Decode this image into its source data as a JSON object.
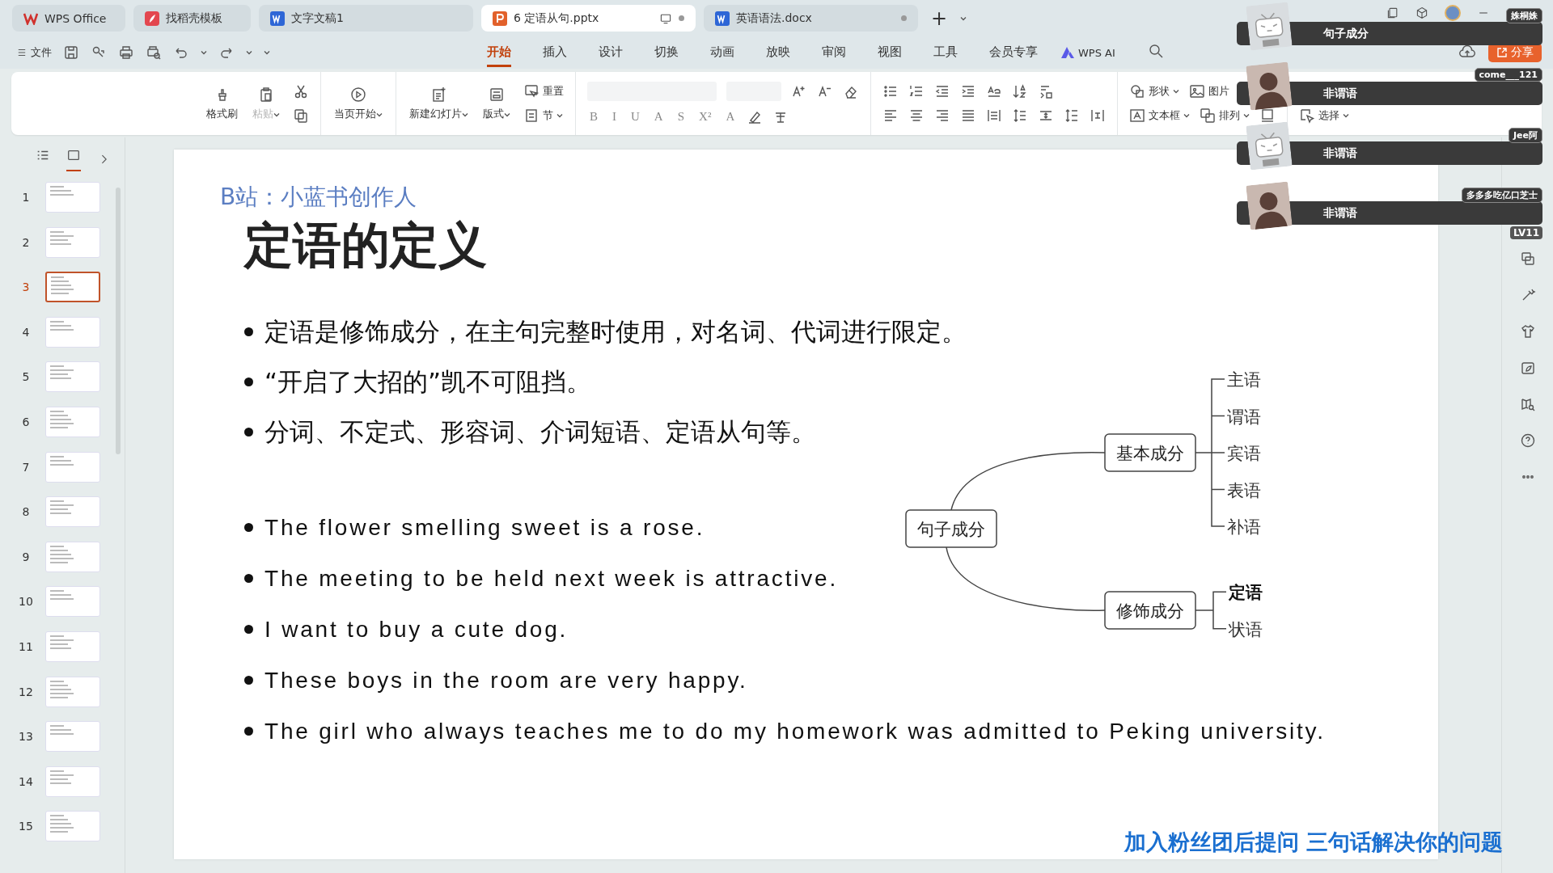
{
  "tabs": [
    {
      "kind": "home",
      "label": "WPS Office",
      "selected": false,
      "dot": false
    },
    {
      "kind": "template",
      "label": "找稻壳模板",
      "selected": false,
      "dot": false
    },
    {
      "kind": "doc",
      "label": "文字文稿1",
      "selected": false,
      "dot": false
    },
    {
      "kind": "ppt",
      "label": "6 定语从句.pptx",
      "selected": true,
      "dot": true
    },
    {
      "kind": "doc",
      "label": "英语语法.docx",
      "selected": false,
      "dot": true
    }
  ],
  "new_tab": "+",
  "menu": {
    "file": "文件",
    "items": [
      {
        "label": "开始",
        "selected": true
      },
      {
        "label": "插入",
        "selected": false
      },
      {
        "label": "设计",
        "selected": false
      },
      {
        "label": "切换",
        "selected": false
      },
      {
        "label": "动画",
        "selected": false
      },
      {
        "label": "放映",
        "selected": false
      },
      {
        "label": "审阅",
        "selected": false
      },
      {
        "label": "视图",
        "selected": false
      },
      {
        "label": "工具",
        "selected": false
      },
      {
        "label": "会员专享",
        "selected": false
      }
    ],
    "ai": "WPS AI",
    "share": "分享"
  },
  "ribbon": [
    {
      "items": [
        {
          "kind": "big",
          "label": "格式刷",
          "dropdown": false,
          "disabled": false
        },
        {
          "kind": "big",
          "label": "粘贴",
          "dropdown": true,
          "disabled": true
        },
        {
          "kind": "stack",
          "top": [
            {
              "kind": "tool"
            }
          ],
          "bottom": [
            {
              "kind": "tool"
            }
          ]
        }
      ]
    },
    {
      "items": [
        {
          "kind": "big",
          "label": "当页开始",
          "dropdown": true,
          "disabled": false
        }
      ]
    },
    {
      "items": [
        {
          "kind": "big",
          "label": "新建幻灯片",
          "dropdown": true,
          "disabled": false
        },
        {
          "kind": "big",
          "label": "版式",
          "dropdown": true,
          "disabled": false
        },
        {
          "kind": "stack",
          "top": [
            {
              "kind": "small",
              "label": "重置",
              "dropdown": false
            }
          ],
          "bottom": [
            {
              "kind": "small",
              "label": "节",
              "dropdown": true
            }
          ]
        }
      ]
    },
    {
      "items": [
        {
          "kind": "stack",
          "top": [
            {
              "kind": "field"
            },
            {
              "kind": "field"
            },
            {
              "kind": "tool"
            },
            {
              "kind": "tool"
            },
            {
              "kind": "tool"
            }
          ],
          "bottom": [
            {
              "kind": "glyph",
              "label": "B"
            },
            {
              "kind": "glyph",
              "label": "I"
            },
            {
              "kind": "glyph",
              "label": "U"
            },
            {
              "kind": "glyph",
              "label": "A"
            },
            {
              "kind": "glyph",
              "label": "S"
            },
            {
              "kind": "glyph",
              "label": "X²"
            },
            {
              "kind": "glyph",
              "label": "A"
            },
            {
              "kind": "tool"
            },
            {
              "kind": "tool"
            }
          ]
        }
      ]
    },
    {
      "items": [
        {
          "kind": "stack",
          "top": [
            {
              "kind": "tool"
            },
            {
              "kind": "tool"
            },
            {
              "kind": "tool"
            },
            {
              "kind": "tool"
            },
            {
              "kind": "tool"
            },
            {
              "kind": "tool"
            },
            {
              "kind": "tool"
            }
          ],
          "bottom": [
            {
              "kind": "tool"
            },
            {
              "kind": "tool"
            },
            {
              "kind": "tool"
            },
            {
              "kind": "tool"
            },
            {
              "kind": "tool"
            },
            {
              "kind": "tool"
            },
            {
              "kind": "tool"
            },
            {
              "kind": "tool"
            },
            {
              "kind": "tool"
            }
          ]
        }
      ]
    },
    {
      "items": [
        {
          "kind": "stack",
          "top": [
            {
              "kind": "small",
              "label": "形状",
              "dropdown": true
            },
            {
              "kind": "small",
              "label": "图片",
              "dropdown": false
            }
          ],
          "bottom": [
            {
              "kind": "small",
              "label": "文本框",
              "dropdown": true
            },
            {
              "kind": "small",
              "label": "排列",
              "dropdown": true
            },
            {
              "kind": "tool"
            }
          ]
        }
      ]
    },
    {
      "items": [
        {
          "kind": "stack",
          "bottom": [
            {
              "kind": "small",
              "label": "选择",
              "dropdown": true
            }
          ]
        }
      ]
    }
  ],
  "views": [
    {
      "selected": false
    },
    {
      "selected": true
    }
  ],
  "thumbnails": [
    {
      "number": "1",
      "selected": false
    },
    {
      "number": "2",
      "selected": false
    },
    {
      "number": "3",
      "selected": true
    },
    {
      "number": "4",
      "selected": false
    },
    {
      "number": "5",
      "selected": false
    },
    {
      "number": "6",
      "selected": false
    },
    {
      "number": "7",
      "selected": false
    },
    {
      "number": "8",
      "selected": false
    },
    {
      "number": "9",
      "selected": false
    },
    {
      "number": "10",
      "selected": false
    },
    {
      "number": "11",
      "selected": false
    },
    {
      "number": "12",
      "selected": false
    },
    {
      "number": "13",
      "selected": false
    },
    {
      "number": "14",
      "selected": false
    },
    {
      "number": "15",
      "selected": false
    }
  ],
  "slide": {
    "watermark": "B站：小蓝书创作人",
    "title": "定语的定义",
    "bullets_cn": [
      "定语是修饰成分，在主句完整时使用，对名词、代词进行限定。",
      "“开启了大招的”凯不可阻挡。",
      "分词、不定式、形容词、介词短语、定语从句等。"
    ],
    "bullets_en": [
      "The flower smelling sweet is a rose.",
      "The meeting to be held next week is attractive.",
      "I want to buy a cute dog.",
      "These boys in the room are very happy.",
      "The girl who always teaches me to do my homework was admitted to Peking university."
    ],
    "mindmap": {
      "root": "句子成分",
      "branches": [
        {
          "label": "基本成分",
          "leaves": [
            {
              "label": "主语",
              "emphasis": false
            },
            {
              "label": "谓语",
              "emphasis": false
            },
            {
              "label": "宾语",
              "emphasis": false
            },
            {
              "label": "表语",
              "emphasis": false
            },
            {
              "label": "补语",
              "emphasis": false
            }
          ]
        },
        {
          "label": "修饰成分",
          "leaves": [
            {
              "label": "定语",
              "emphasis": true
            },
            {
              "label": "状语",
              "emphasis": false
            }
          ]
        }
      ]
    }
  },
  "comments": [
    {
      "user": "姝桐姝",
      "text": "句子成分",
      "kind": "tv"
    },
    {
      "user": "come___121",
      "text": "非谓语",
      "kind": "photo"
    },
    {
      "user": "Jee阿",
      "text": "非谓语",
      "kind": "tv"
    },
    {
      "user": "多多多吃亿口芝士",
      "text": "非谓语",
      "kind": "photo"
    }
  ],
  "level_badge": "LV11",
  "caption": "加入粉丝团后提问 三句话解决你的问题"
}
